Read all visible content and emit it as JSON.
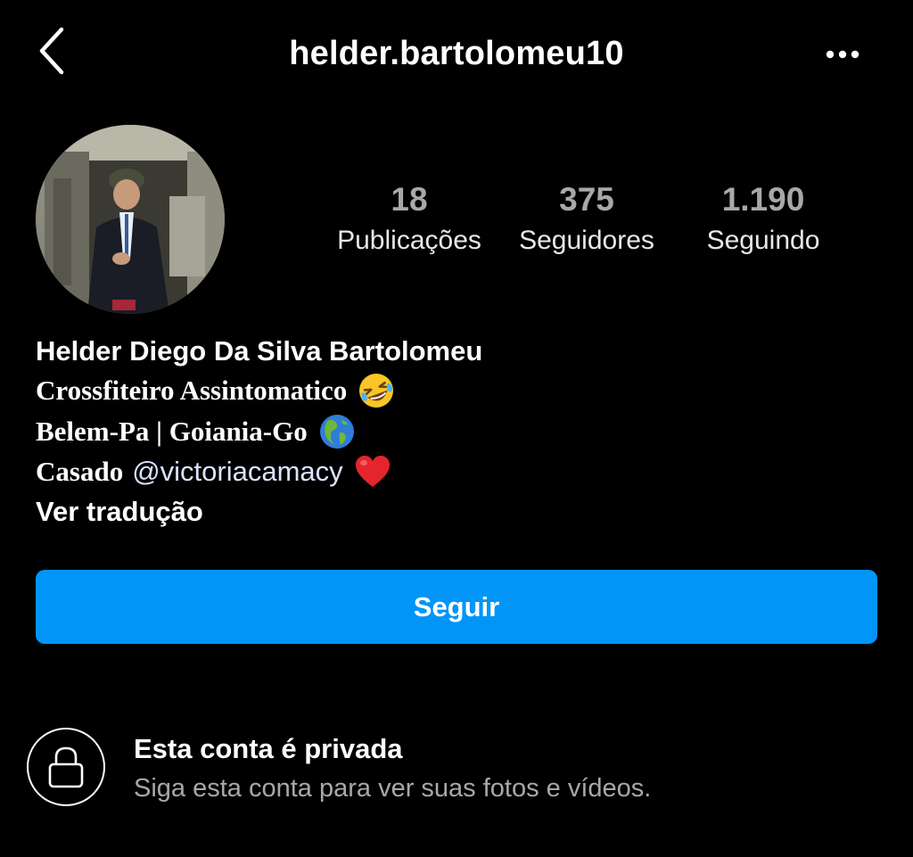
{
  "header": {
    "username": "helder.bartolomeu10",
    "back_icon": "chevron-left-icon",
    "more_icon": "more-horizontal-icon"
  },
  "profile": {
    "avatar_icon": "profile-photo",
    "stats": [
      {
        "value": "18",
        "label": "Publicações"
      },
      {
        "value": "375",
        "label": "Seguidores"
      },
      {
        "value": "1.190",
        "label": "Seguindo"
      }
    ]
  },
  "bio": {
    "name": "Helder Diego Da Silva Bartolomeu",
    "line1": {
      "text": "Crossfiteiro Assintomatico",
      "emoji": "rolling-on-floor-laughing-emoji"
    },
    "line2": {
      "text": "Belem-Pa | Goiania-Go",
      "emoji": "globe-americas-emoji"
    },
    "line3": {
      "text": "Casado",
      "mention": "@victoriacamacy",
      "emoji": "red-heart-emoji"
    },
    "translate": "Ver tradução"
  },
  "actions": {
    "follow_label": "Seguir"
  },
  "private": {
    "icon": "lock-icon",
    "title": "Esta conta é privada",
    "subtitle": "Siga esta conta para ver suas fotos e vídeos."
  },
  "colors": {
    "background": "#000000",
    "accent": "#0095f6",
    "secondary_text": "#a8a8a8",
    "mention": "#dbe4ff"
  }
}
